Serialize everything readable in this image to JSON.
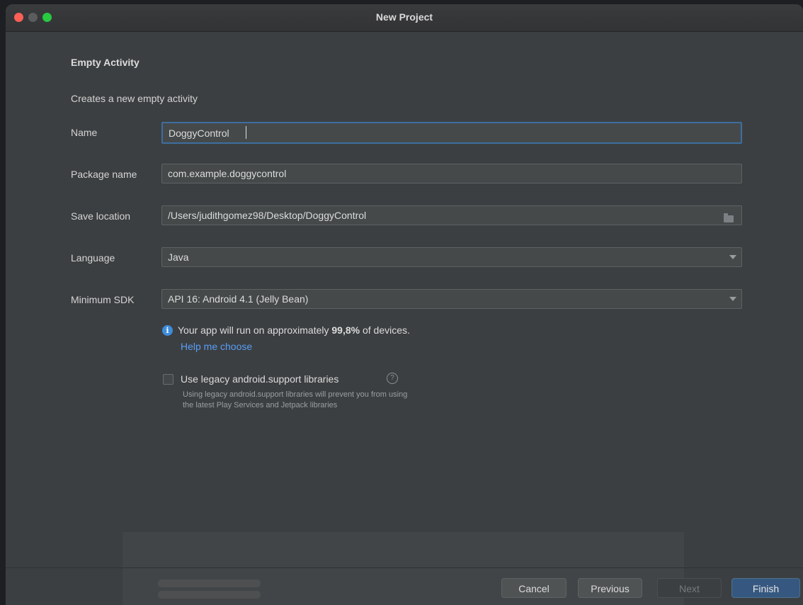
{
  "window": {
    "title": "New Project"
  },
  "form": {
    "heading": "Empty Activity",
    "description": "Creates a new empty activity",
    "name": {
      "label": "Name",
      "value": "DoggyControl"
    },
    "package": {
      "label": "Package name",
      "value": "com.example.doggycontrol"
    },
    "save_location": {
      "label": "Save location",
      "value": "/Users/judithgomez98/Desktop/DoggyControl"
    },
    "language": {
      "label": "Language",
      "value": "Java"
    },
    "min_sdk": {
      "label": "Minimum SDK",
      "value": "API 16: Android 4.1 (Jelly Bean)"
    },
    "info": {
      "prefix": "Your app will run on approximately ",
      "percent": "99,8%",
      "suffix": " of devices.",
      "link": "Help me choose"
    },
    "legacy": {
      "label": "Use legacy android.support libraries",
      "checked": false,
      "hint_line1": "Using legacy android.support libraries will prevent you from using",
      "hint_line2": "the latest Play Services and Jetpack libraries"
    }
  },
  "buttons": {
    "cancel": "Cancel",
    "previous": "Previous",
    "next": "Next",
    "finish": "Finish"
  },
  "colors": {
    "background": "#3c3f41",
    "field_bg": "#45494a",
    "focus_border": "#3d6ea0",
    "link": "#589df6",
    "finish_button": "#365880"
  }
}
